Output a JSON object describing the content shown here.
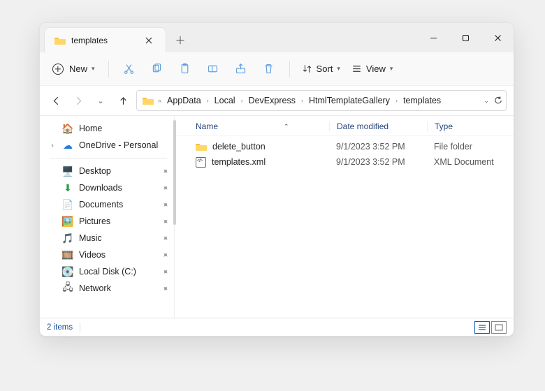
{
  "tab": {
    "title": "templates"
  },
  "toolbar": {
    "new_label": "New",
    "sort_label": "Sort",
    "view_label": "View"
  },
  "breadcrumbs": [
    "AppData",
    "Local",
    "DevExpress",
    "HtmlTemplateGallery",
    "templates"
  ],
  "sidebar": {
    "home": "Home",
    "onedrive": "OneDrive - Personal",
    "quick": [
      {
        "label": "Desktop",
        "icon": "desktop"
      },
      {
        "label": "Downloads",
        "icon": "downloads"
      },
      {
        "label": "Documents",
        "icon": "documents"
      },
      {
        "label": "Pictures",
        "icon": "pictures"
      },
      {
        "label": "Music",
        "icon": "music"
      },
      {
        "label": "Videos",
        "icon": "videos"
      },
      {
        "label": "Local Disk (C:)",
        "icon": "disk"
      },
      {
        "label": "Network",
        "icon": "network"
      }
    ]
  },
  "columns": {
    "name": "Name",
    "date": "Date modified",
    "type": "Type"
  },
  "rows": [
    {
      "name": "delete_button",
      "date": "9/1/2023 3:52 PM",
      "type": "File folder",
      "kind": "folder"
    },
    {
      "name": "templates.xml",
      "date": "9/1/2023 3:52 PM",
      "type": "XML Document",
      "kind": "xml"
    }
  ],
  "status": {
    "count_label": "2 items"
  }
}
